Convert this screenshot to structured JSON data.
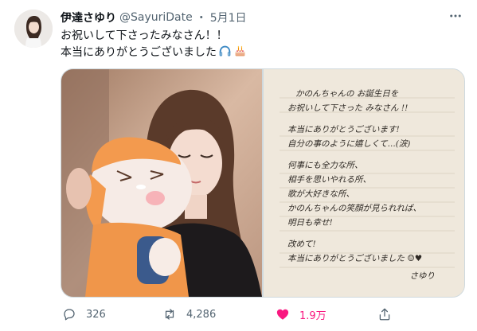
{
  "author": {
    "display_name": "伊達さゆり",
    "handle": "@SayuriDate",
    "separator": "・",
    "date": "5月1日"
  },
  "tweet": {
    "line1": "お祝いして下さったみなさん！！",
    "line2": "本当にありがとうございました",
    "emojis": [
      "headphone-emoji",
      "cake-emoji"
    ]
  },
  "media": {
    "left_photo": "photo-girl-with-plush",
    "right_photo": {
      "note_lines": [
        "かのんちゃんの お誕生日を",
        "お祝いして下さった みなさん !!",
        "本当にありがとうございます!",
        "自分の事のように嬉しくて...(涙)",
        "何事にも全力な所、",
        "相手を思いやれる所、",
        "歌が大好きな所、",
        "かのんちゃんの笑顔が見られれば、",
        "明日も幸せ!",
        "改めて!",
        "本当にありがとうございました ☺♥",
        "さゆり"
      ]
    }
  },
  "actions": {
    "reply_count": "326",
    "retweet_count": "4,286",
    "like_count": "1.9万",
    "like_color": "#f91880",
    "muted_color": "#536471"
  }
}
